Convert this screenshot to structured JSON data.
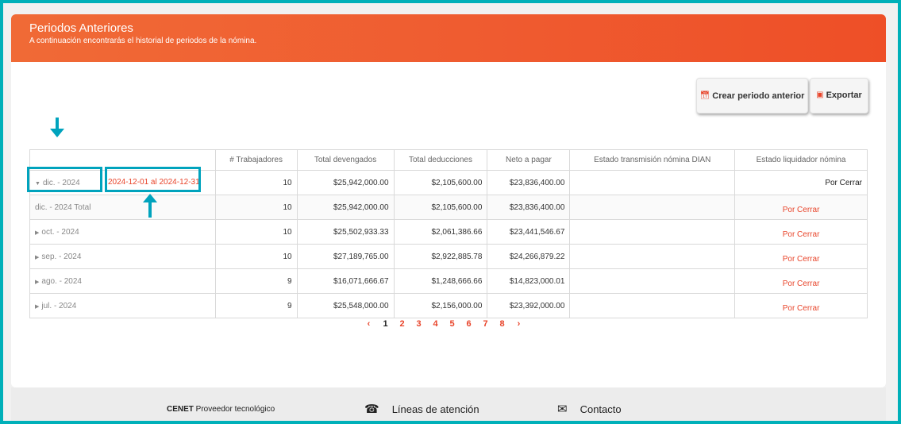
{
  "header": {
    "title": "Periodos Anteriores",
    "subtitle": "A continuación encontrarás el historial de periodos de la nómina."
  },
  "toolbar": {
    "crear_label": "Crear periodo anterior",
    "exportar_label": "Exportar"
  },
  "table": {
    "columns": [
      "",
      "# Trabajadores",
      "Total devengados",
      "Total deducciones",
      "Neto a pagar",
      "Estado transmisión nómina DIAN",
      "Estado liquidador nómina"
    ],
    "rows": [
      {
        "label": "dic. - 2024",
        "range": "2024-12-01 al 2024-12-31",
        "trabajadores": "10",
        "devengados": "$25,942,000.00",
        "deducciones": "$2,105,600.00",
        "neto": "$23,836,400.00",
        "dian": "",
        "estado": "Por Cerrar"
      },
      {
        "label": "dic. - 2024 Total",
        "trabajadores": "10",
        "devengados": "$25,942,000.00",
        "deducciones": "$2,105,600.00",
        "neto": "$23,836,400.00",
        "dian": "",
        "estado": "Por Cerrar"
      },
      {
        "label": "oct. - 2024",
        "trabajadores": "10",
        "devengados": "$25,502,933.33",
        "deducciones": "$2,061,386.66",
        "neto": "$23,441,546.67",
        "dian": "",
        "estado": "Por Cerrar"
      },
      {
        "label": "sep. - 2024",
        "trabajadores": "10",
        "devengados": "$27,189,765.00",
        "deducciones": "$2,922,885.78",
        "neto": "$24,266,879.22",
        "dian": "",
        "estado": "Por Cerrar"
      },
      {
        "label": "ago. - 2024",
        "trabajadores": "9",
        "devengados": "$16,071,666.67",
        "deducciones": "$1,248,666.66",
        "neto": "$14,823,000.01",
        "dian": "",
        "estado": "Por Cerrar"
      },
      {
        "label": "jul. - 2024",
        "trabajadores": "9",
        "devengados": "$25,548,000.00",
        "deducciones": "$2,156,000.00",
        "neto": "$23,392,000.00",
        "dian": "",
        "estado": "Por Cerrar"
      }
    ]
  },
  "pager": {
    "prev": "‹",
    "next": "›",
    "pages": [
      "1",
      "2",
      "3",
      "4",
      "5",
      "6",
      "7",
      "8"
    ],
    "active": "1"
  },
  "footer": {
    "brand_bold": "CENET",
    "brand_rest": " Proveedor tecnológico",
    "lineas": "Líneas de atención",
    "contacto": "Contacto"
  },
  "icons": {
    "calendar": "calendar-icon",
    "export": "file-export-icon",
    "phone": "phone-icon",
    "mail": "envelope-icon"
  },
  "colors": {
    "accent": "#ef5b30",
    "highlight": "#00a3bd"
  }
}
